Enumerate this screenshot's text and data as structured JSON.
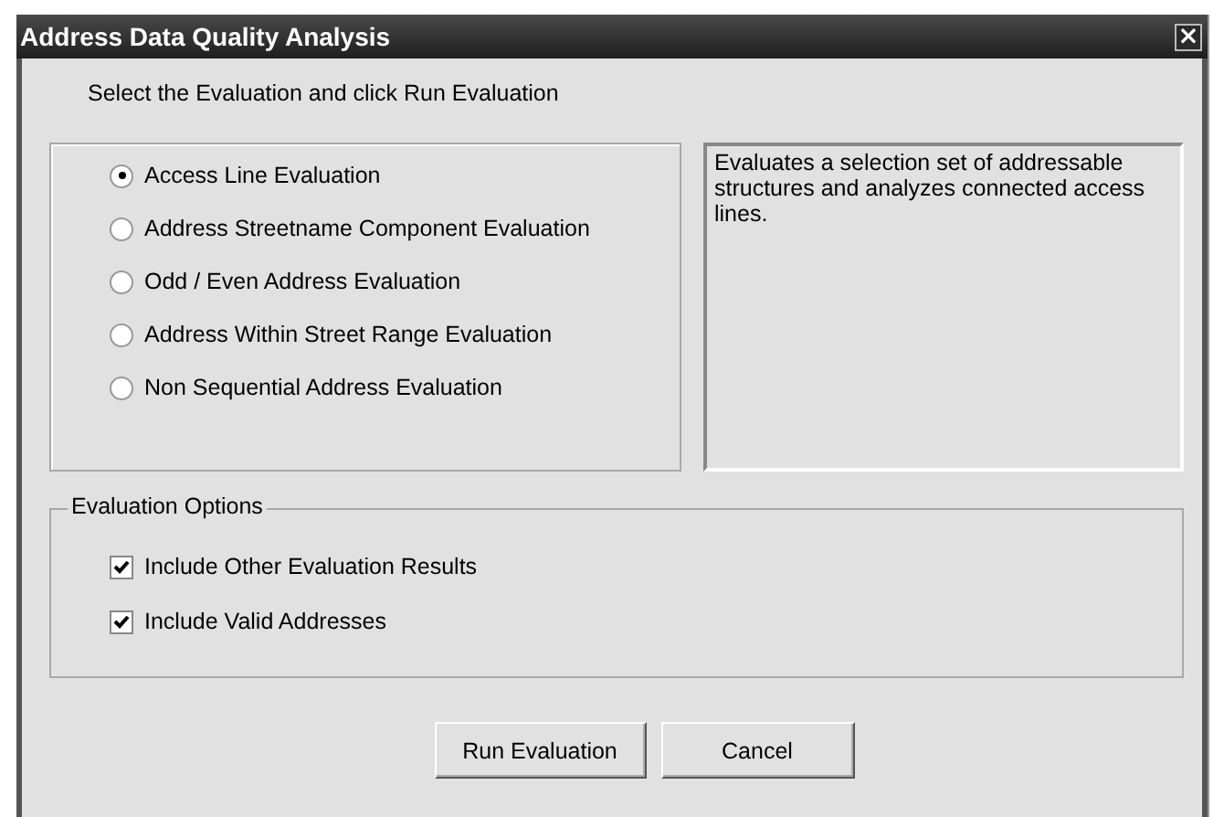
{
  "window": {
    "title": "Address Data Quality Analysis",
    "close": "×"
  },
  "instruction": "Select the Evaluation and click Run Evaluation",
  "evaluations": [
    {
      "label": "Access Line Evaluation",
      "selected": true
    },
    {
      "label": "Address Streetname Component Evaluation",
      "selected": false
    },
    {
      "label": "Odd / Even Address Evaluation",
      "selected": false
    },
    {
      "label": "Address Within Street Range Evaluation",
      "selected": false
    },
    {
      "label": "Non Sequential Address Evaluation",
      "selected": false
    }
  ],
  "description": "Evaluates a selection set of addressable structures and analyzes connected access lines.",
  "options": {
    "legend": "Evaluation Options",
    "items": [
      {
        "label": "Include Other Evaluation Results",
        "checked": true
      },
      {
        "label": "Include Valid Addresses",
        "checked": true
      }
    ]
  },
  "buttons": [
    "Run Evaluation",
    "Cancel"
  ]
}
